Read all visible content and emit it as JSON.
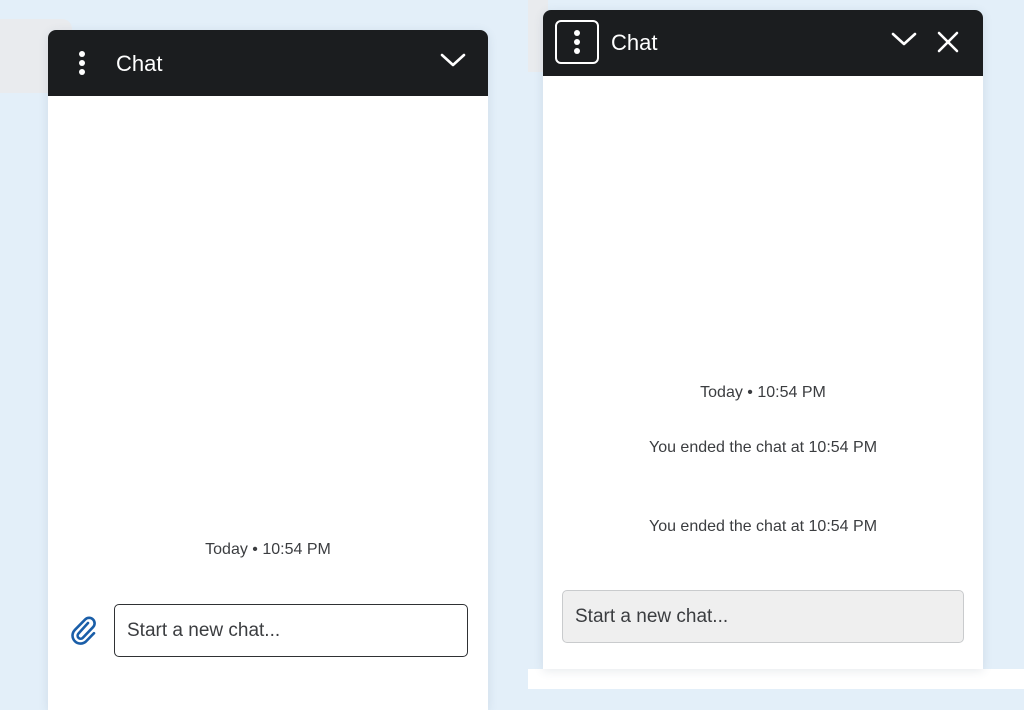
{
  "left_widget": {
    "title": "Chat",
    "timestamp": "Today • 10:54 PM",
    "input_placeholder": "Start a new chat...",
    "icons": {
      "menu": "more-vertical-icon",
      "collapse": "chevron-down-icon",
      "attach": "paperclip-icon"
    }
  },
  "right_widget": {
    "title": "Chat",
    "timestamp": "Today • 10:54 PM",
    "messages": [
      "You ended the chat at 10:54 PM",
      "You ended the chat at 10:54 PM"
    ],
    "input_placeholder": "Start a new chat...",
    "icons": {
      "menu": "more-vertical-icon",
      "collapse": "chevron-down-icon",
      "close": "close-icon"
    }
  },
  "colors": {
    "header_bg": "#1b1d1f",
    "page_bg": "#e3eff9",
    "attach_icon": "#1a5ea8",
    "text": "#3b3d40"
  }
}
